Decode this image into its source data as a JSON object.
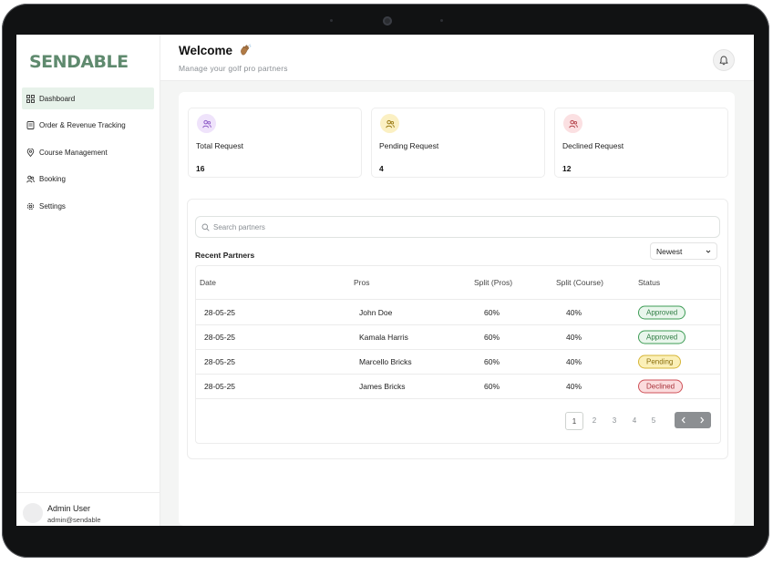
{
  "app": {
    "logo": "SENDABLE"
  },
  "sidebar": {
    "items": [
      {
        "label": "Dashboard",
        "icon": "grid-icon",
        "active": true
      },
      {
        "label": "Order & Revenue Tracking",
        "icon": "receipt-icon",
        "active": false
      },
      {
        "label": "Course Management",
        "icon": "map-pin-icon",
        "active": false
      },
      {
        "label": "Booking",
        "icon": "users-icon",
        "active": false
      },
      {
        "label": "Settings",
        "icon": "gear-icon",
        "active": false
      }
    ],
    "user": {
      "name": "Admin User",
      "email": "admin@sendable"
    }
  },
  "header": {
    "title": "Welcome",
    "subtitle": "Manage your golf pro partners",
    "icon": "waving-hand-icon",
    "bell_icon": "bell-icon"
  },
  "stats": [
    {
      "label": "Total Request",
      "value": "16",
      "color": "#efe3fb",
      "icon_color": "#8e5cc7"
    },
    {
      "label": "Pending Request",
      "value": "4",
      "color": "#fbf0c3",
      "icon_color": "#9a7a12"
    },
    {
      "label": "Declined Request",
      "value": "12",
      "color": "#fbe0e2",
      "icon_color": "#b5434b"
    }
  ],
  "partners": {
    "search_placeholder": "Search partners",
    "title": "Recent Partners",
    "sort_label": "Newest",
    "columns": [
      "Date",
      "Pros",
      "Split (Pros)",
      "Split (Course)",
      "Status"
    ],
    "rows": [
      {
        "date": "28-05-25",
        "pro": "John Doe",
        "split_pros": "60%",
        "split_course": "40%",
        "status": "Approved"
      },
      {
        "date": "28-05-25",
        "pro": "Kamala Harris",
        "split_pros": "60%",
        "split_course": "40%",
        "status": "Approved"
      },
      {
        "date": "28-05-25",
        "pro": "Marcello Bricks",
        "split_pros": "60%",
        "split_course": "40%",
        "status": "Pending"
      },
      {
        "date": "28-05-25",
        "pro": "James Bricks",
        "split_pros": "60%",
        "split_course": "40%",
        "status": "Declined"
      }
    ],
    "pagination": {
      "pages": [
        "1",
        "2",
        "3",
        "4",
        "5"
      ],
      "current": "1"
    }
  },
  "status_colors": {
    "Approved": {
      "bg": "#e9f6ec",
      "border": "#3d9c55",
      "text": "#2f7d43"
    },
    "Pending": {
      "bg": "#fbf0b8",
      "border": "#d6b536",
      "text": "#8a6e0c"
    },
    "Declined": {
      "bg": "#fbdcdd",
      "border": "#cf5259",
      "text": "#a8323a"
    }
  },
  "accent": "#5f8a6e"
}
